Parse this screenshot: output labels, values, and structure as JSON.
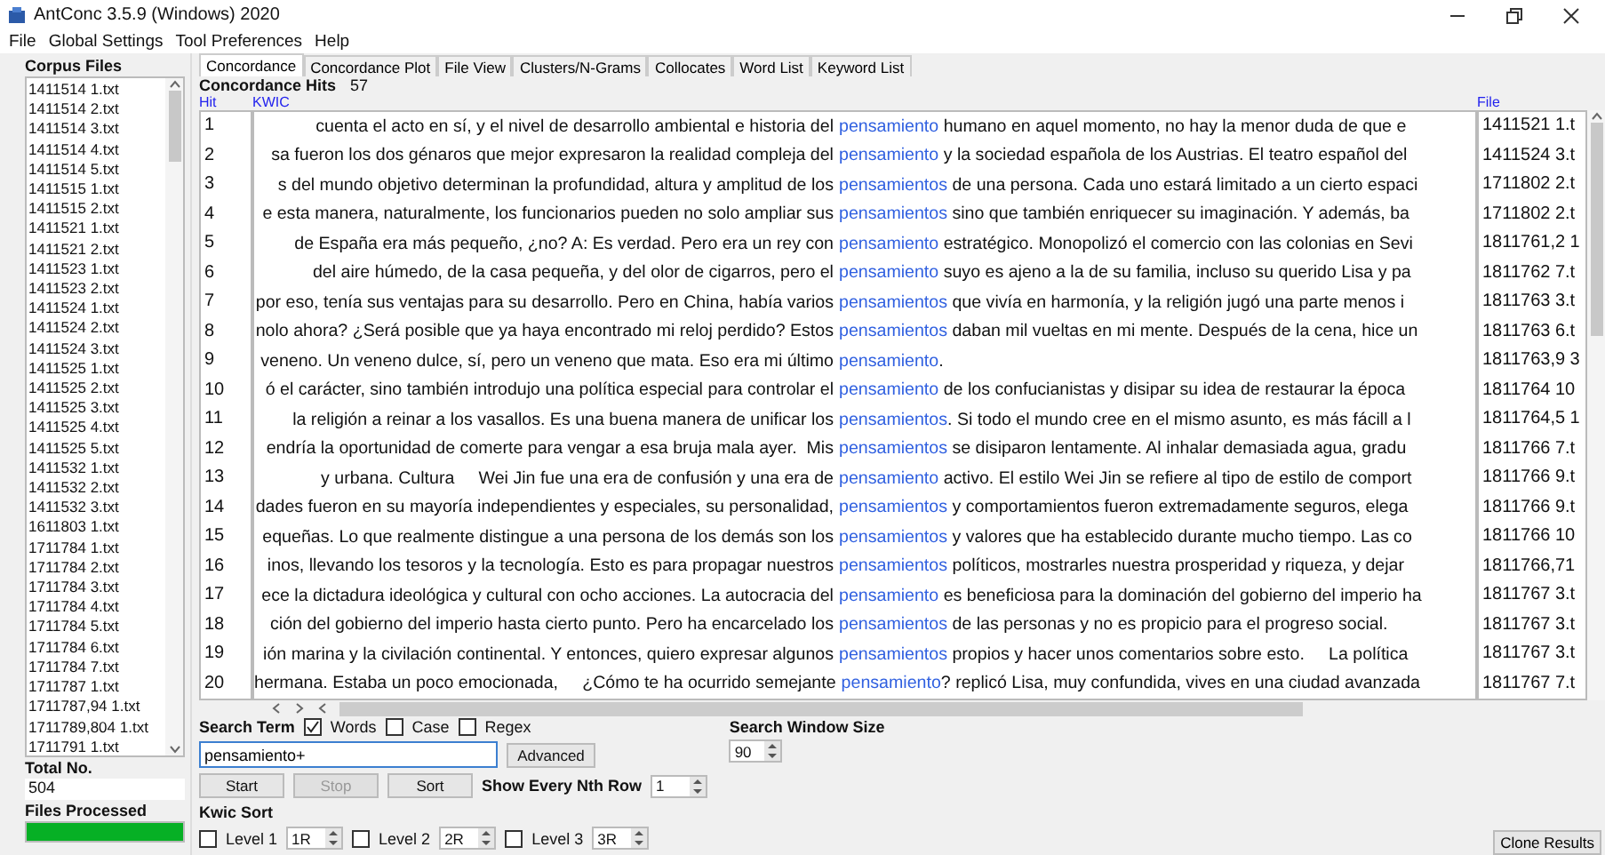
{
  "window": {
    "title": "AntConc 3.5.9 (Windows) 2020"
  },
  "menu": [
    "File",
    "Global Settings",
    "Tool Preferences",
    "Help"
  ],
  "corpus": {
    "title": "Corpus Files",
    "files": [
      "1411514 1.txt",
      "1411514 2.txt",
      "1411514 3.txt",
      "1411514 4.txt",
      "1411514 5.txt",
      "1411515 1.txt",
      "1411515 2.txt",
      "1411521 1.txt",
      "1411521 2.txt",
      "1411523 1.txt",
      "1411523 2.txt",
      "1411524 1.txt",
      "1411524 2.txt",
      "1411524 3.txt",
      "1411525 1.txt",
      "1411525 2.txt",
      "1411525 3.txt",
      "1411525 4.txt",
      "1411525 5.txt",
      "1411532 1.txt",
      "1411532 2.txt",
      "1411532 3.txt",
      "1611803 1.txt",
      "1711784 1.txt",
      "1711784 2.txt",
      "1711784 3.txt",
      "1711784 4.txt",
      "1711784 5.txt",
      "1711784 6.txt",
      "1711784 7.txt",
      "1711787 1.txt",
      "1711787,94 1.txt",
      "1711789,804 1.txt",
      "1711791 1.txt"
    ],
    "total_label": "Total No.",
    "total": "504",
    "processed_label": "Files Processed",
    "progress": {
      "level": 1
    }
  },
  "tabs": [
    {
      "label": "Concordance",
      "selected": true
    },
    {
      "label": "Concordance Plot",
      "selected": false
    },
    {
      "label": "File View",
      "selected": false
    },
    {
      "label": "Clusters/N-Grams",
      "selected": false
    },
    {
      "label": "Collocates",
      "selected": false
    },
    {
      "label": "Word List",
      "selected": false
    },
    {
      "label": "Keyword List",
      "selected": false
    }
  ],
  "hits_label": "Concordance Hits",
  "hits": "57",
  "columns": [
    "Hit",
    "KWIC",
    "File"
  ],
  "rows": [
    {
      "hit": "1",
      "left": "cuenta el acto en sí, y el nivel de desarrollo ambiental e historia del",
      "key": "pensamiento",
      "right": " humano en aquel momento, no hay la menor duda de que e",
      "file": "1411521 1.t"
    },
    {
      "hit": "2",
      "left": "sa fueron los dos génaros que mejor expresaron la realidad compleja del",
      "key": "pensamiento",
      "right": " y la sociedad española de los Austrias. El teatro español del",
      "file": "1411524 3.t"
    },
    {
      "hit": "3",
      "left": "s del mundo objetivo determinan la profundidad, altura y amplitud de los",
      "key": "pensamientos",
      "right": " de una persona. Cada uno estará limitado a un cierto espaci",
      "file": "1711802 2.t"
    },
    {
      "hit": "4",
      "left": "e esta manera, naturalmente, los funcionarios pueden no solo ampliar sus",
      "key": "pensamientos",
      "right": " sino que también enriquecer su imaginación. Y además, ba",
      "file": "1711802 2.t"
    },
    {
      "hit": "5",
      "left": "de España era más pequeño, ¿no? A: Es verdad. Pero era un rey con",
      "key": "pensamiento",
      "right": " estratégico. Monopolizó el comercio con las colonias en Sevi",
      "file": "1811761,2 1"
    },
    {
      "hit": "6",
      "left": "del aire húmedo, de la casa pequeña, y del olor de cigarros, pero el",
      "key": "pensamiento",
      "right": " suyo es ajeno a la de su familia, incluso su querido Lisa y pa",
      "file": "1811762 7.t"
    },
    {
      "hit": "7",
      "left": "por eso, tenía sus ventajas para su desarrollo. Pero en China, había varios",
      "key": "pensamientos",
      "right": " que vivía en harmonía, y la religión jugó una parte menos i",
      "file": "1811763 3.t"
    },
    {
      "hit": "8",
      "left": "nolo ahora? ¿Será posible que ya haya encontrado mi reloj perdido? Estos",
      "key": "pensamientos",
      "right": " daban mil vueltas en mi mente. Después de la cena, hice un",
      "file": "1811763 6.t"
    },
    {
      "hit": "9",
      "left": "veneno. Un veneno dulce, sí, pero un veneno que mata. Eso era mi último",
      "key": "pensamiento",
      "right": ".",
      "file": "1811763,9 3"
    },
    {
      "hit": "10",
      "left": "ó el carácter, sino también introdujo una política especial para controlar el",
      "key": "pensamiento",
      "right": " de los confucianistas y disipar su idea de restaurar la época",
      "file": "1811764 10"
    },
    {
      "hit": "11",
      "left": "la religión a reinar a los vasallos. Es una buena manera de unificar los",
      "key": "pensamientos",
      "right": ". Si todo el mundo cree en el mismo asunto, es más fácill a l",
      "file": "1811764,5 1"
    },
    {
      "hit": "12",
      "left": "endría la oportunidad de comerte para vengar a esa bruja mala ayer.  Mis",
      "key": "pensamientos",
      "right": " se disiparon lentamente. Al inhalar demasiada agua, gradu",
      "file": "1811766 7.t"
    },
    {
      "hit": "13",
      "left": "y urbana. Cultura     Wei Jin fue una era de confusión y una era de",
      "key": "pensamiento",
      "right": " activo. El estilo Wei Jin se refiere al tipo de estilo de comport",
      "file": "1811766 9.t"
    },
    {
      "hit": "14",
      "left": "dades fueron en su mayoría independientes y especiales, su personalidad,",
      "key": "pensamientos",
      "right": " y comportamientos fueron extremadamente seguros, elega",
      "file": "1811766 9.t"
    },
    {
      "hit": "15",
      "left": "equeñas. Lo que realmente distingue a una persona de los demás son los",
      "key": "pensamientos",
      "right": " y valores que ha establecido durante mucho tiempo. Las co",
      "file": "1811766 10"
    },
    {
      "hit": "16",
      "left": "inos, llevando los tesoros y la tecnología. Esto es para propagar nuestros",
      "key": "pensamientos",
      "right": " políticos, mostrarles nuestra prosperidad y riqueza, y dejar",
      "file": "1811766,71"
    },
    {
      "hit": "17",
      "left": "ece la dictadura ideológica y cultural con ocho acciones. La autocracia del",
      "key": "pensamiento",
      "right": " es beneficiosa para la dominación del gobierno del imperio ha",
      "file": "1811767 3.t"
    },
    {
      "hit": "18",
      "left": "ción del gobierno del imperio hasta cierto punto. Pero ha encarcelado los",
      "key": "pensamientos",
      "right": " de las personas y no es propicio para el progreso social.",
      "file": "1811767 3.t"
    },
    {
      "hit": "19",
      "left": "ión marina y la civilación continental. Y entonces, quiero expresar algunos",
      "key": "pensamientos",
      "right": " propios y hacer unos comentarios sobre esto.     La política",
      "file": "1811767 3.t"
    },
    {
      "hit": "20",
      "left": "hermana. Estaba un poco emocionada,     ¿Cómo te ha ocurrido semejante",
      "key": "pensamiento",
      "right": "? replicó Lisa, muy confundida, vives en una ciudad avanzada",
      "file": "1811767 7.t"
    }
  ],
  "search": {
    "label": "Search Term",
    "options": [
      {
        "label": "Words",
        "checked": true
      },
      {
        "label": "Case",
        "checked": false
      },
      {
        "label": "Regex",
        "checked": false
      }
    ],
    "value": "pensamiento+",
    "advanced": "Advanced",
    "buttons": [
      {
        "label": "Start",
        "disabled": false
      },
      {
        "label": "Stop",
        "disabled": true
      },
      {
        "label": "Sort",
        "disabled": false
      }
    ],
    "nth_label": "Show Every Nth Row",
    "nth": "1",
    "window_label": "Search Window Size",
    "window": "90"
  },
  "kwic_sort": {
    "label": "Kwic Sort",
    "levels": [
      {
        "label": "Level 1",
        "value": "1R",
        "checked": false
      },
      {
        "label": "Level 2",
        "value": "2R",
        "checked": false
      },
      {
        "label": "Level 3",
        "value": "3R",
        "checked": false
      }
    ]
  },
  "clone": "Clone Results"
}
